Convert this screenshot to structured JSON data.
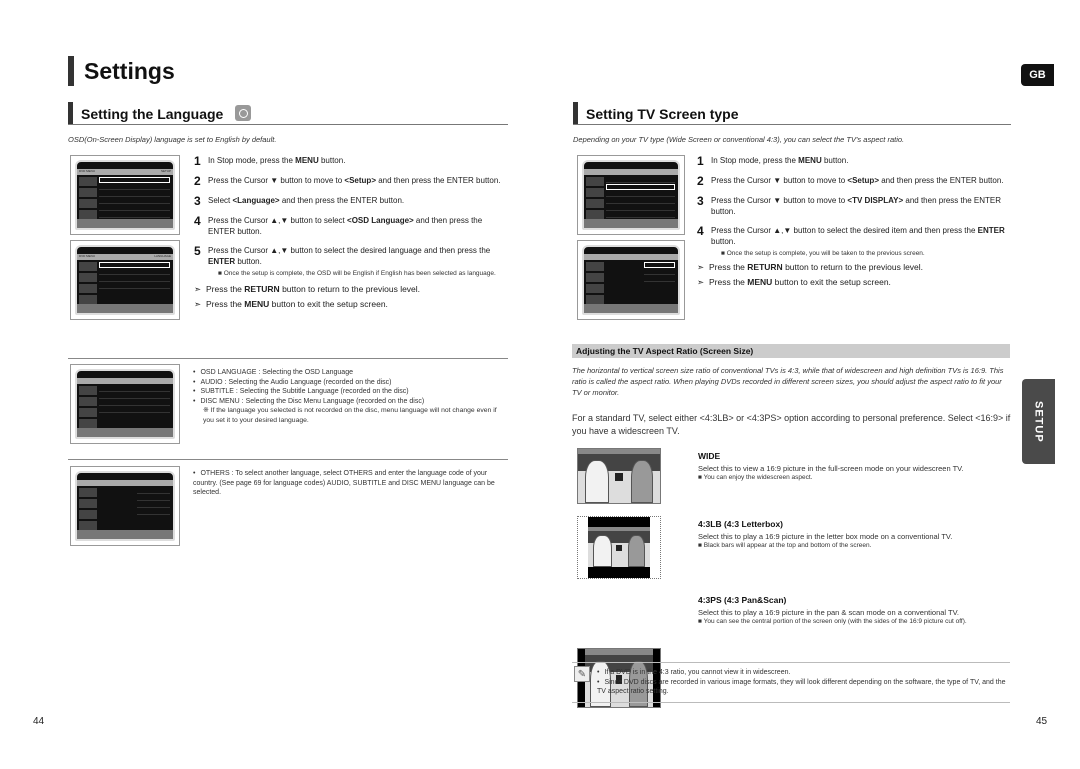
{
  "page_title": "Settings",
  "tabs": {
    "language_badge": "GB",
    "side_tab": "SETUP"
  },
  "left": {
    "section_title": "Setting the Language",
    "section_icon": "dvd-disc-icon",
    "intro": "OSD(On-Screen Display) language is set to English by default.",
    "osd_screen_1": {
      "header_left": "DVD MENU",
      "header_right": "SETUP",
      "rows": [
        "LANGUAGE",
        "TV DISPLAY : WIDE",
        "PARENTAL : OFF",
        "PASSWORD : CHANGE",
        "LOGO : ORIGINAL",
        "DVD TYPE : DVD-AUDIO"
      ],
      "footer": "MOVE  ENTER  RETURN  EXIT"
    },
    "osd_screen_2": {
      "header_left": "DVD MENU",
      "header_right": "LANGUAGE",
      "rows": [
        "OSD LANGUAGE : ENGLISH",
        "AUDIO : ENGLISH",
        "SUBTITLE : KOREAN",
        "DISC MENU : KOREAN"
      ],
      "footer": "MOVE  ENTER  RETURN  EXIT"
    },
    "steps": [
      {
        "num": "1",
        "pre": "In Stop mode, press the ",
        "bold": "MENU",
        "post": " button."
      },
      {
        "num": "2",
        "pre": "Press the Cursor ▼ button to move to ",
        "bold": "<Setup>",
        "post": " and then press the ENTER button."
      },
      {
        "num": "3",
        "pre": "Select ",
        "bold": "<Language>",
        "post": " and then press the ENTER button."
      },
      {
        "num": "4",
        "pre": "Press the Cursor ▲,▼ button to select ",
        "bold": "<OSD Language>",
        "post": " and then press the ENTER button."
      },
      {
        "num": "5",
        "pre": "Press the Cursor ▲,▼ button to select the desired language and then press the ",
        "bold": "ENTER",
        "post": " button."
      }
    ],
    "step5_note": "Once the setup is complete, the OSD will be English if English has been selected as language.",
    "tips": [
      {
        "pre": "Press the ",
        "bold": "RETURN",
        "post": " button to return to the previous level."
      },
      {
        "pre": "Press the ",
        "bold": "MENU",
        "post": " button to exit the setup screen."
      }
    ],
    "language_bullets": [
      "OSD LANGUAGE : Selecting the OSD Language",
      "AUDIO : Selecting the Audio Language (recorded on the disc)",
      "SUBTITLE : Selecting the Subtitle Language (recorded on the disc)",
      "DISC MENU : Selecting the Disc Menu Language (recorded on the disc)"
    ],
    "language_note": "※ If the language you selected is not recorded on the disc, menu language will not change even if you set it to your desired language.",
    "others_bullet": "OTHERS : To select another language, select OTHERS and enter the language code of your country. (See page 69 for language codes) AUDIO, SUBTITLE and DISC MENU language can be selected.",
    "page_number": "44"
  },
  "right": {
    "section_title": "Setting TV Screen type",
    "intro": "Depending on your TV type (Wide Screen  or conventional 4:3), you can select the TV's aspect ratio.",
    "steps": [
      {
        "num": "1",
        "pre": "In Stop mode, press the ",
        "bold": "MENU",
        "post": " button."
      },
      {
        "num": "2",
        "pre": "Press the Cursor ▼ button to move to ",
        "bold": "<Setup>",
        "post": " and then press the ENTER button."
      },
      {
        "num": "3",
        "pre": "Press the Cursor ▼ button to move to ",
        "bold": "<TV DISPLAY>",
        "post": " and then press the ENTER button."
      },
      {
        "num": "4",
        "pre": "Press the Cursor ▲,▼ button to select the desired item and then press the ",
        "bold": "ENTER",
        "post": " button."
      }
    ],
    "step4_note": "Once the setup is complete, you will be taken to the previous screen.",
    "tips": [
      {
        "pre": "Press the ",
        "bold": "RETURN",
        "post": " button to return to the previous level."
      },
      {
        "pre": "Press the ",
        "bold": "MENU",
        "post": " button to exit the setup screen."
      }
    ],
    "subheading": "Adjusting the TV Aspect Ratio (Screen Size)",
    "aspect_intro": "The horizontal to vertical screen size ratio of conventional TVs is 4:3, while that of widescreen and high definition TVs is 16:9. This ratio is called the aspect ratio. When playing DVDs recorded in different screen sizes, you should adjust the aspect ratio to fit your TV or monitor.",
    "standard_tv": "For a standard TV, select either <4:3LB> or <4:3PS> option according to personal preference. Select <16:9> if you have a widescreen TV.",
    "options": [
      {
        "title": "WIDE",
        "desc": "Select this to view a 16:9 picture in the full-screen mode on your widescreen TV.",
        "note": "You can enjoy the widescreen aspect."
      },
      {
        "title": "4:3LB (4:3 Letterbox)",
        "desc": "Select this to play a 16:9 picture in the letter box mode on a conventional TV.",
        "note": "Black bars will appear at the top and bottom of the screen."
      },
      {
        "title": "4:3PS (4:3 Pan&Scan)",
        "desc": "Select this to play a 16:9 picture in the pan & scan mode on a conventional TV.",
        "note": "You can see the central portion of the screen only (with the sides of the 16:9 picture cut off)."
      }
    ],
    "notes": [
      "If a DVD is in the 4:3 ratio, you cannot view it in widescreen.",
      "Since DVD discs are recorded in various image formats, they will look different depending on the software, the type of TV, and the TV aspect ratio setting."
    ],
    "page_number": "45"
  }
}
